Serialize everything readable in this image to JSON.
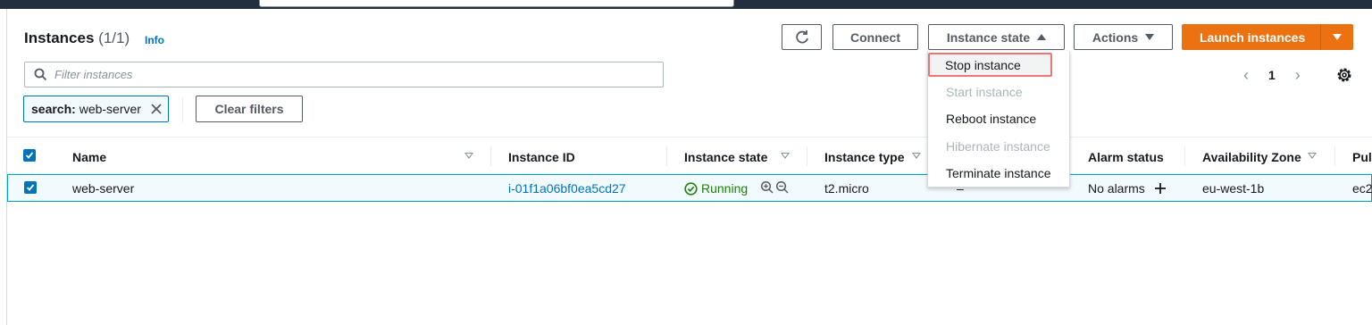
{
  "header": {
    "title": "Instances",
    "count": "(1/1)",
    "info_link": "Info"
  },
  "toolbar": {
    "refresh_icon": "refresh-icon",
    "connect_label": "Connect",
    "instance_state_label": "Instance state",
    "actions_label": "Actions",
    "launch_label": "Launch instances"
  },
  "filter": {
    "placeholder": "Filter instances",
    "token_key": "search:",
    "token_value": "web-server",
    "clear_label": "Clear filters"
  },
  "pagination": {
    "page": "1"
  },
  "table": {
    "columns": [
      "Name",
      "Instance ID",
      "Instance state",
      "Instance type",
      "Alarm status",
      "Availability Zone",
      "Pul"
    ],
    "rows": [
      {
        "name": "web-server",
        "instance_id": "i-01f1a06bf0ea5cd27",
        "state": "Running",
        "type": "t2.micro",
        "status_check": "–",
        "alarm_status": "No alarms",
        "zone": "eu-west-1b",
        "public": "ec2"
      }
    ]
  },
  "instance_state_menu": {
    "items": [
      {
        "label": "Stop instance",
        "enabled": true,
        "highlighted": true
      },
      {
        "label": "Start instance",
        "enabled": false
      },
      {
        "label": "Reboot instance",
        "enabled": true
      },
      {
        "label": "Hibernate instance",
        "enabled": false
      },
      {
        "label": "Terminate instance",
        "enabled": true
      }
    ]
  },
  "colors": {
    "accent": "#0073bb",
    "primary_button": "#ec7211",
    "running": "#1d8102",
    "highlight_border": "#ee7575"
  }
}
